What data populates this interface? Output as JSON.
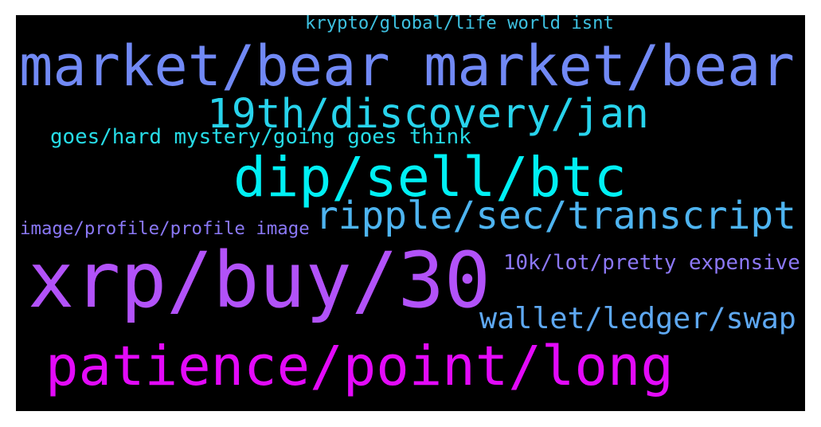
{
  "word_cloud": {
    "background": "#000000",
    "words": [
      {
        "text": "krypto/global/life world isnt",
        "color": "#3ec1e0"
      },
      {
        "text": "market/bear market/bear",
        "color": "#7189f5"
      },
      {
        "text": "19th/discovery/jan",
        "color": "#28d3ec"
      },
      {
        "text": "goes/hard mystery/going goes think",
        "color": "#27dce7"
      },
      {
        "text": "dip/sell/btc",
        "color": "#00f0f4"
      },
      {
        "text": "ripple/sec/transcript",
        "color": "#4eb4f0"
      },
      {
        "text": "image/profile/profile image",
        "color": "#8a78f6"
      },
      {
        "text": "xrp/buy/30",
        "color": "#b252f9"
      },
      {
        "text": "10k/lot/pretty expensive",
        "color": "#8c78f6"
      },
      {
        "text": "wallet/ledger/swap",
        "color": "#5ea8f2"
      },
      {
        "text": "patience/point/long",
        "color": "#e30af9"
      }
    ]
  }
}
